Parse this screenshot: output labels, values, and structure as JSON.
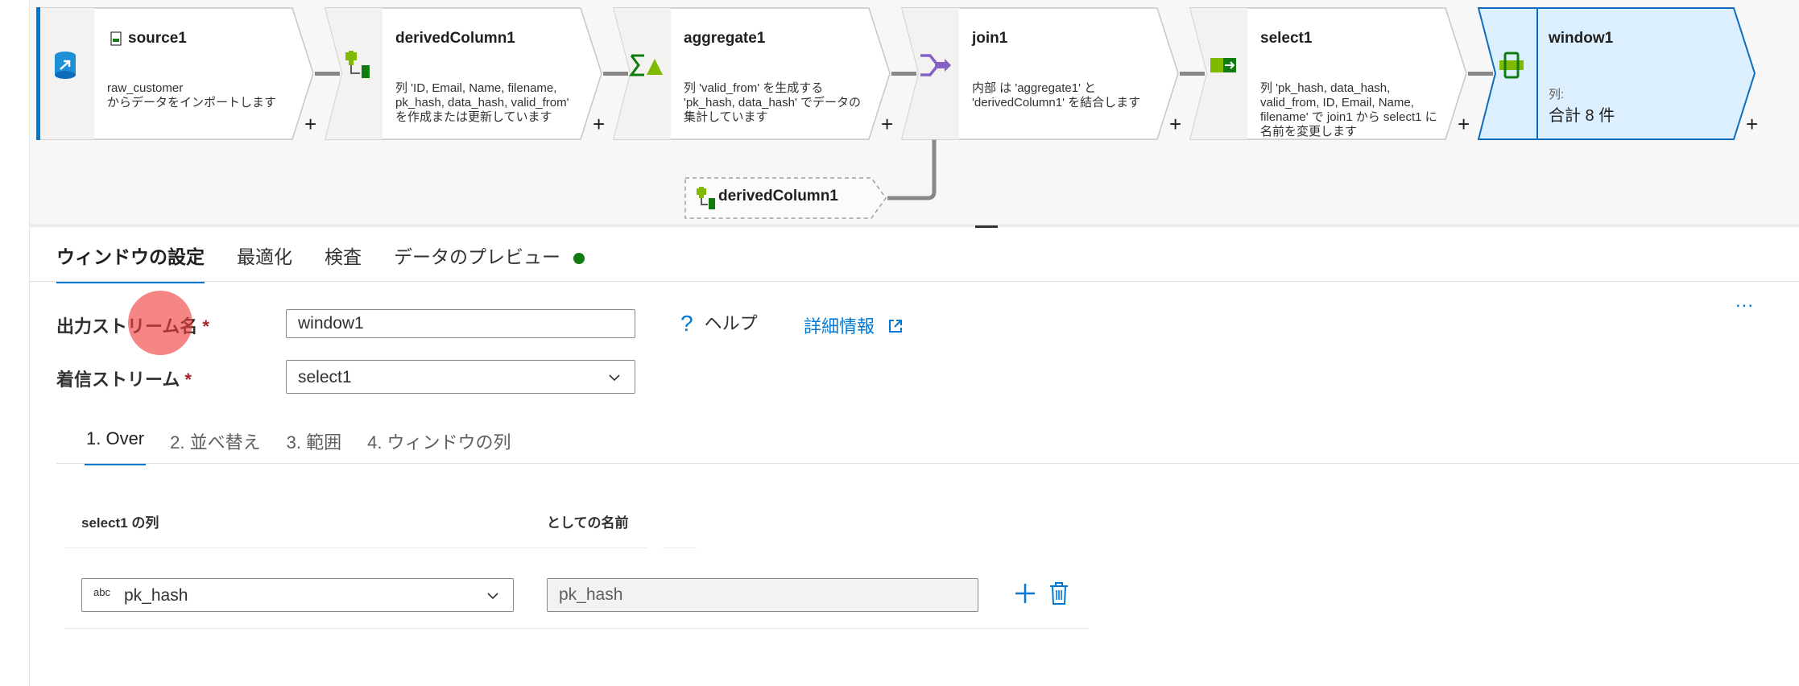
{
  "pipeline": {
    "nodes": [
      {
        "id": "source1",
        "title": "source1",
        "desc": "raw_customer\nからデータをインポートします",
        "icon": "source-icon"
      },
      {
        "id": "derivedColumn1",
        "title": "derivedColumn1",
        "desc": "列 'ID, Email, Name, filename, pk_hash, data_hash, valid_from' を作成または更新しています",
        "icon": "derived-column-icon"
      },
      {
        "id": "aggregate1",
        "title": "aggregate1",
        "desc": "列 'valid_from' を生成する 'pk_hash, data_hash' でデータの集計しています",
        "icon": "aggregate-icon"
      },
      {
        "id": "join1",
        "title": "join1",
        "desc": "内部 は 'aggregate1' と 'derivedColumn1' を結合します",
        "icon": "join-icon"
      },
      {
        "id": "select1",
        "title": "select1",
        "desc": "列 'pk_hash, data_hash, valid_from, ID, Email, Name, filename' で join1 から select1 に名前を変更します",
        "icon": "select-icon"
      },
      {
        "id": "window1",
        "title": "window1",
        "desc_label": "列:",
        "desc_value": "合計 8 件",
        "icon": "window-icon",
        "selected": true
      }
    ],
    "add_symbol": "+",
    "branch_node": {
      "title": "derivedColumn1",
      "icon": "derived-column-icon"
    }
  },
  "tabs": [
    {
      "label": "ウィンドウの設定",
      "active": true
    },
    {
      "label": "最適化"
    },
    {
      "label": "検査"
    },
    {
      "label": "データのプレビュー"
    }
  ],
  "form": {
    "output_stream_label": "出力ストリーム名",
    "output_stream_value": "window1",
    "incoming_stream_label": "着信ストリーム",
    "incoming_stream_value": "select1",
    "required_mark": "*",
    "help_label": "ヘルプ",
    "help_symbol": "?",
    "more_info_label": "詳細情報",
    "more_label": "..."
  },
  "subtabs": [
    {
      "label": "1. Over",
      "active": true
    },
    {
      "label": "2. 並べ替え"
    },
    {
      "label": "3. 範囲"
    },
    {
      "label": "4. ウィンドウの列"
    }
  ],
  "over": {
    "col1_header": "select1 の列",
    "col2_header": "としての名前",
    "row": {
      "type_badge": "abc",
      "column": "pk_hash",
      "alias": "pk_hash"
    }
  },
  "colors": {
    "accent": "#0078d4",
    "selected_node_bg": "#dcefff",
    "status_green": "#107c10"
  }
}
